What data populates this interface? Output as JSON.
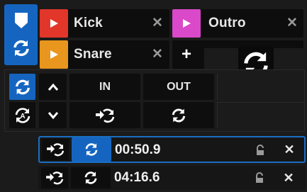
{
  "cues": [
    {
      "label": "Kick",
      "color": "#e2362a"
    },
    {
      "label": "Outro",
      "color": "#d949c9"
    },
    {
      "label": "Snare",
      "color": "#e8961d"
    }
  ],
  "cue_add_label": "+",
  "loop_buttons": {
    "in_label": "IN",
    "out_label": "OUT"
  },
  "loops": [
    {
      "time": "00:50.9",
      "active": true
    },
    {
      "time": "04:16.6",
      "active": false
    }
  ],
  "close_glyph": "✕",
  "accent": "#1a6fc3"
}
